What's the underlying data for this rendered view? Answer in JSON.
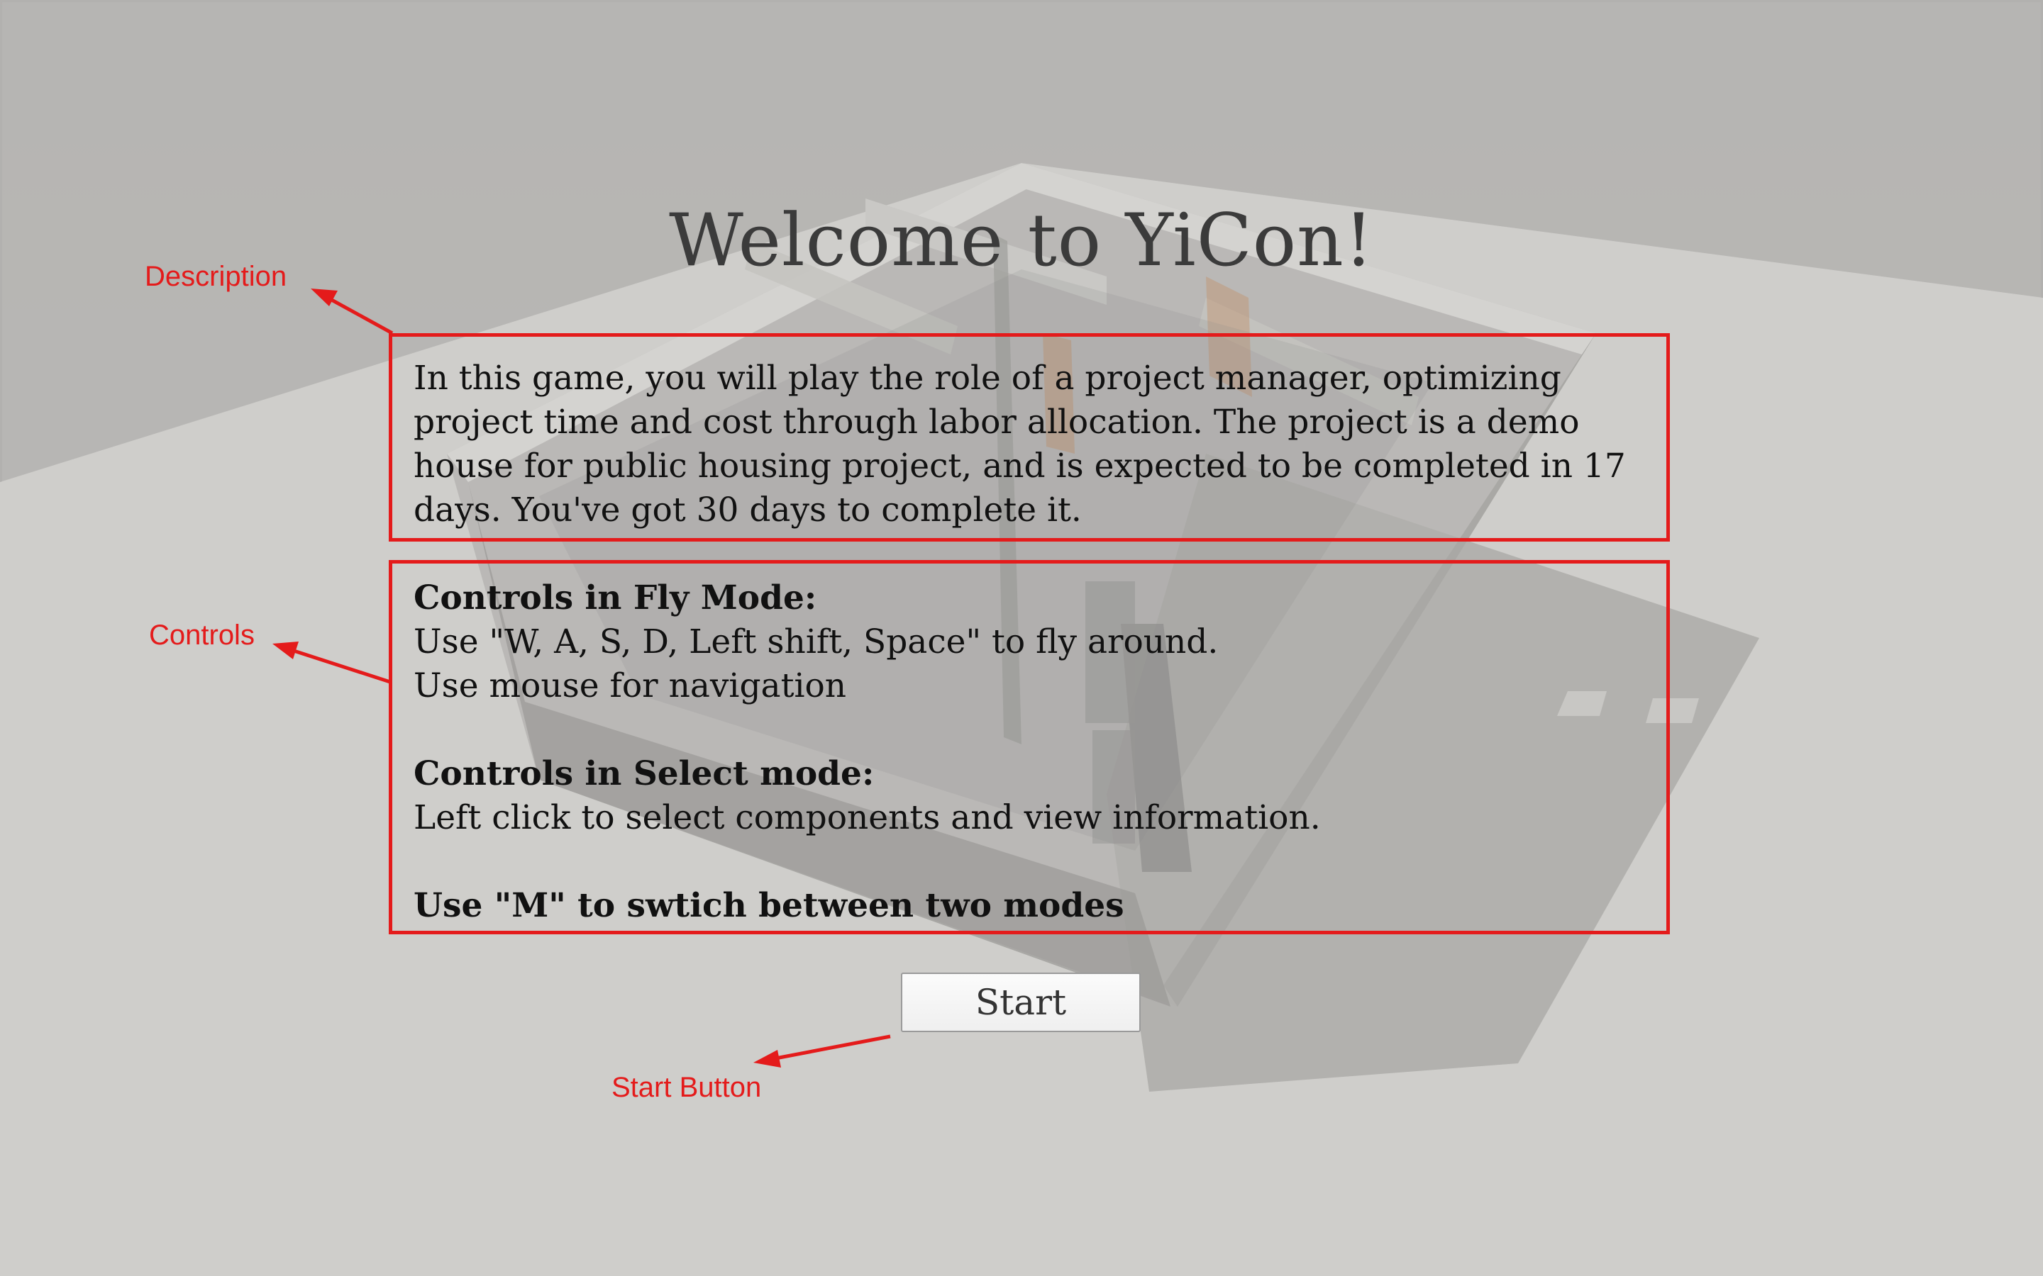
{
  "title": "Welcome to YiCon!",
  "description": {
    "lines": [
      "In this game, you will play the role of a project manager, optimizing",
      "project time and cost through labor allocation. The project is a demo",
      "house for public housing project, and is expected to be completed in 17",
      "days. You've got 30 days to complete it."
    ]
  },
  "controls": {
    "fly_heading": "Controls in Fly Mode:",
    "fly_line1": "Use \"W, A, S, D, Left shift, Space\" to fly around.",
    "fly_line2": "Use mouse for navigation",
    "select_heading": "Controls in Select mode:",
    "select_line1": "Left click to select components and view information.",
    "switch_line": "Use \"M\" to swtich between two modes"
  },
  "start_button": {
    "label": "Start"
  },
  "annotations": {
    "description": "Description",
    "controls": "Controls",
    "start_button": "Start Button",
    "color": "#e41b1b"
  }
}
